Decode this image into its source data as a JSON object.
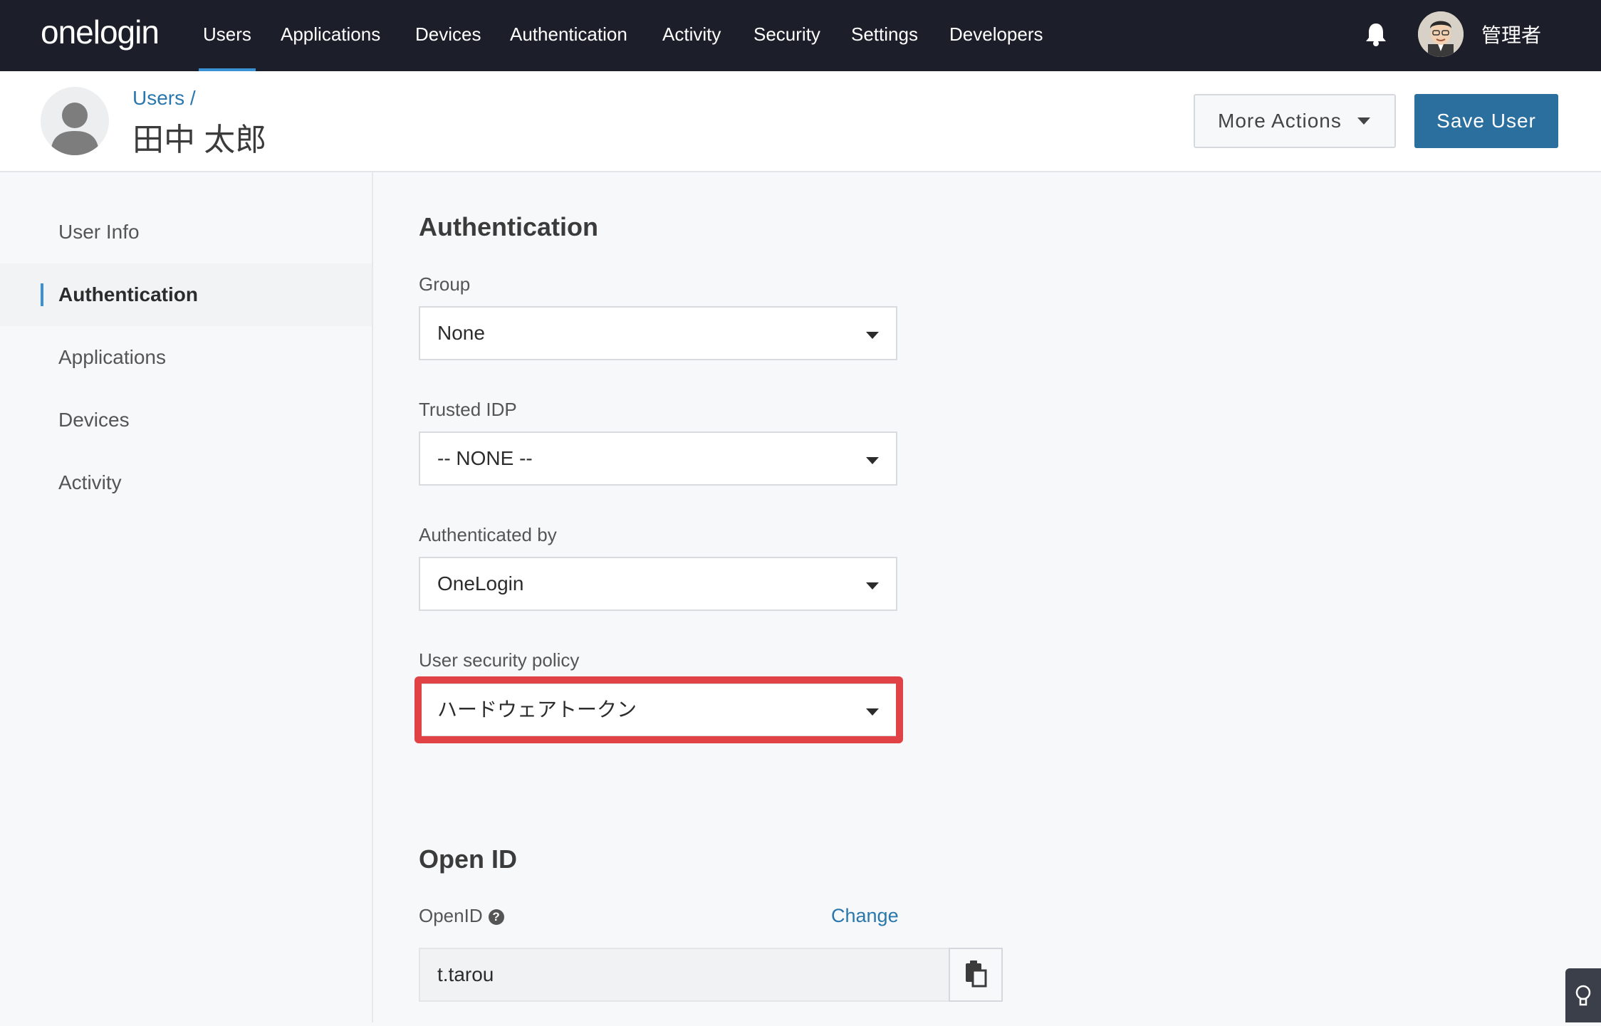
{
  "topnav": {
    "logo": "onelogin",
    "items": [
      "Users",
      "Applications",
      "Devices",
      "Authentication",
      "Activity",
      "Security",
      "Settings",
      "Developers"
    ],
    "active": "Users",
    "username": "管理者"
  },
  "header": {
    "breadcrumb": "Users /",
    "title": "田中 太郎",
    "more_actions": "More Actions",
    "save": "Save User"
  },
  "sidebar": {
    "items": [
      "User Info",
      "Authentication",
      "Applications",
      "Devices",
      "Activity"
    ],
    "active": "Authentication"
  },
  "authentication": {
    "title": "Authentication",
    "group": {
      "label": "Group",
      "value": "None"
    },
    "trusted_idp": {
      "label": "Trusted IDP",
      "value": "-- NONE --"
    },
    "authenticated_by": {
      "label": "Authenticated by",
      "value": "OneLogin"
    },
    "security_policy": {
      "label": "User security policy",
      "value": "ハードウェアトークン"
    }
  },
  "openid": {
    "title": "Open ID",
    "label": "OpenID",
    "help": "?",
    "change": "Change",
    "value": "t.tarou"
  },
  "colors": {
    "nav_bg": "#1c1f2a",
    "accent": "#3a92d4",
    "primary_button": "#2b6f9e",
    "highlight": "#e04246"
  }
}
